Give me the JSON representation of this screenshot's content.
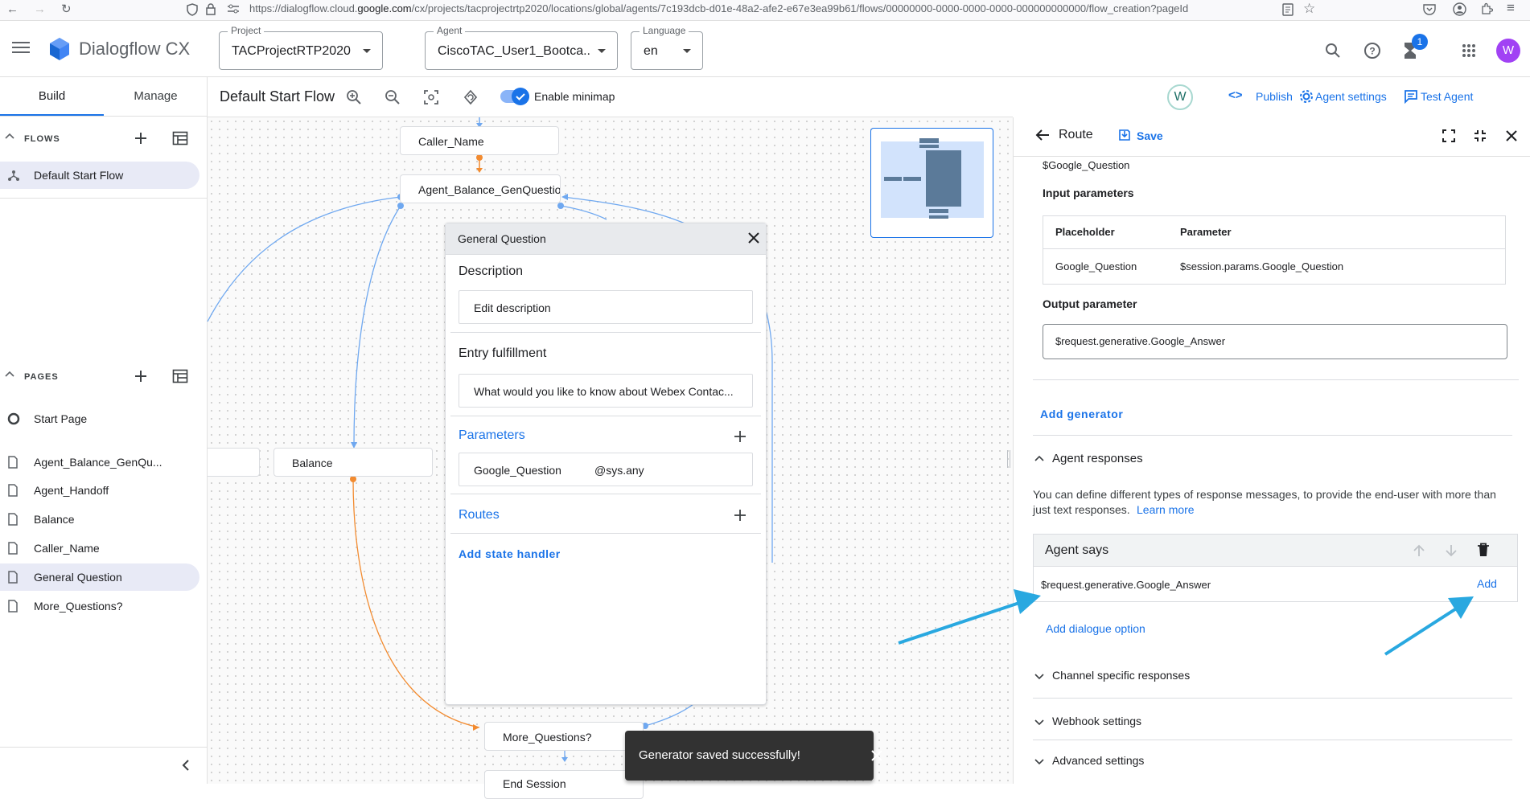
{
  "browser": {
    "url_prefix": "https://dialogflow.cloud.",
    "url_domain": "google.com",
    "url_rest": "/cx/projects/tacprojectrtp2020/locations/global/agents/7c193dcb-d01e-48a2-afe2-e67e3ea99b61/flows/00000000-0000-0000-0000-000000000000/flow_creation?pageId"
  },
  "header": {
    "app_name": "Dialogflow CX",
    "project_label": "Project",
    "project_value": "TACProjectRTP2020",
    "agent_label": "Agent",
    "agent_value": "CiscoTAC_User1_Bootca...",
    "language_label": "Language",
    "language_value": "en",
    "notification_count": "1",
    "avatar_letter": "W"
  },
  "sidebar": {
    "tabs": [
      {
        "label": "Build"
      },
      {
        "label": "Manage"
      }
    ],
    "flows_title": "FLOWS",
    "flows": [
      {
        "label": "Default Start Flow"
      }
    ],
    "pages_title": "PAGES",
    "pages": [
      {
        "label": "Start Page"
      },
      {
        "label": "Agent_Balance_GenQu..."
      },
      {
        "label": "Agent_Handoff"
      },
      {
        "label": "Balance"
      },
      {
        "label": "Caller_Name"
      },
      {
        "label": "General Question"
      },
      {
        "label": "More_Questions?"
      }
    ]
  },
  "toolbar": {
    "flow_title": "Default Start Flow",
    "minimap_label": "Enable minimap",
    "avatar_letter": "W",
    "publish_label": "Publish",
    "agent_settings_label": "Agent settings",
    "test_agent_label": "Test Agent"
  },
  "canvas": {
    "nodes": {
      "caller_name": "Caller_Name",
      "agent_balance": "Agent_Balance_GenQuestion",
      "balance": "Balance",
      "more_questions": "More_Questions?",
      "end_session": "End Session"
    }
  },
  "page_card": {
    "title": "General Question",
    "description_heading": "Description",
    "description_value": "Edit description",
    "entry_heading": "Entry fulfillment",
    "entry_value": "What would you like to know about Webex Contac...",
    "parameters_heading": "Parameters",
    "param_name": "Google_Question",
    "param_type": "@sys.any",
    "routes_heading": "Routes",
    "add_state_handler": "Add state handler"
  },
  "route_panel": {
    "title": "Route",
    "save_label": "Save",
    "truncated_text": "$Google_Question",
    "input_params_heading": "Input parameters",
    "table_headers": [
      "Placeholder",
      "Parameter"
    ],
    "table_rows": [
      [
        "Google_Question",
        "$session.params.Google_Question"
      ]
    ],
    "output_param_heading": "Output parameter",
    "output_param_value": "$request.generative.Google_Answer",
    "add_generator": "Add generator",
    "agent_responses_heading": "Agent responses",
    "agent_responses_desc_1": "You can define different types of response messages, to provide the end-user with more than",
    "agent_responses_desc_2": "just text responses.",
    "learn_more": "Learn more",
    "agent_says_heading": "Agent says",
    "agent_says_value": "$request.generative.Google_Answer",
    "add_label": "Add",
    "add_dialogue_option": "Add dialogue option",
    "channel_specific": "Channel specific responses",
    "webhook_settings": "Webhook settings",
    "advanced_settings": "Advanced settings"
  },
  "snackbar": {
    "message": "Generator saved successfully!"
  },
  "colors": {
    "accent": "#1a73e8",
    "annotation_arrow": "#29a8e0",
    "orange_edge": "#f28b30",
    "blue_edge": "#6fa8f0"
  }
}
